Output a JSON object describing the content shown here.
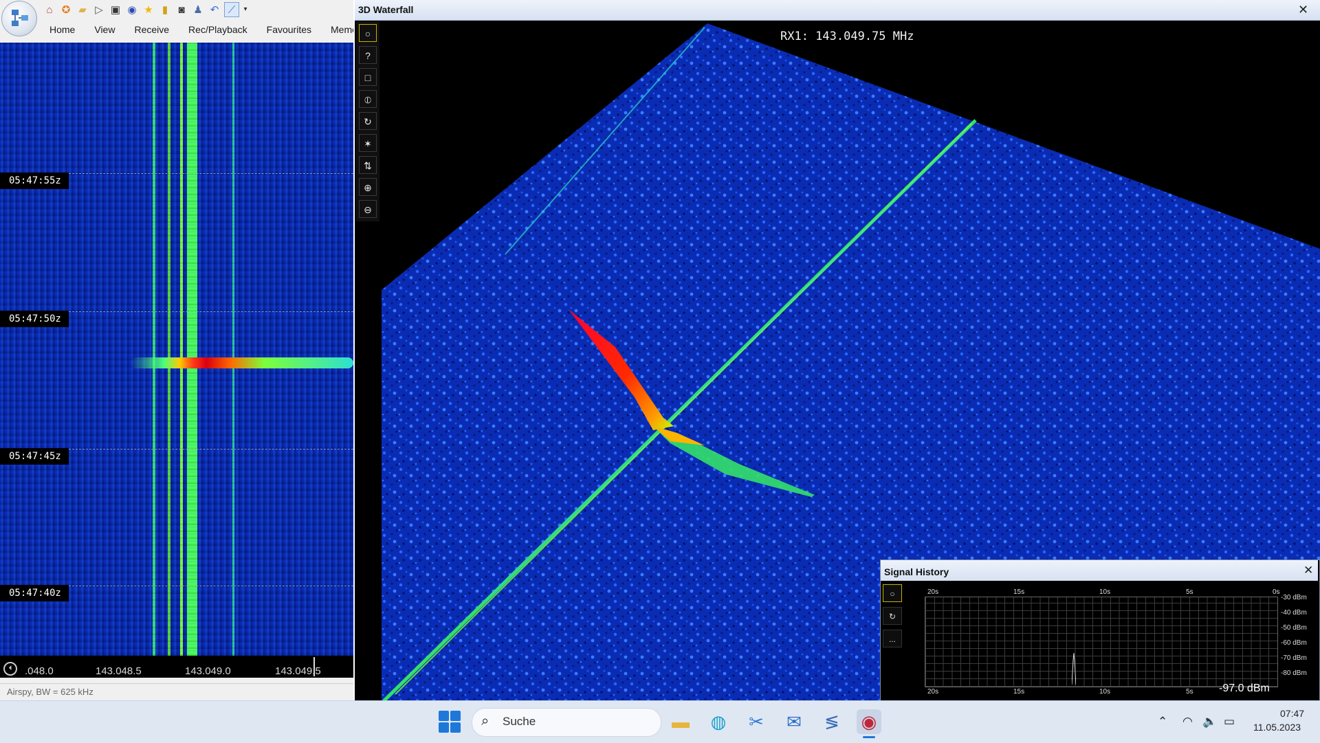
{
  "quick_access": {
    "icons": [
      "home-icon",
      "help-ring-icon",
      "folder-icon",
      "play-icon",
      "stop-icon",
      "radio-icon",
      "star-icon",
      "lock-icon",
      "camera-icon",
      "user-icon",
      "undo-icon",
      "spectrum-icon",
      "dropdown-icon"
    ]
  },
  "menu": {
    "tabs": [
      "Home",
      "View",
      "Receive",
      "Rec/Playback",
      "Favourites",
      "Memor"
    ]
  },
  "left_waterfall": {
    "timestamps": [
      "05:47:55z",
      "05:47:50z",
      "05:47:45z",
      "05:47:40z"
    ],
    "freq_ticks": [
      ".048.0",
      "143.048.5",
      "143.049.0",
      "143.049.5"
    ],
    "status": "Airspy, BW = 625 kHz"
  },
  "waterfall_3d": {
    "title": "3D Waterfall",
    "close": "✕",
    "rx_label": "RX1: 143.049.75 MHz",
    "tools": [
      "○",
      "?",
      "□",
      "⦶",
      "↻",
      "✶",
      "⇅",
      "⊕",
      "⊖"
    ]
  },
  "signal_history": {
    "title": "Signal History",
    "close": "✕",
    "tools": [
      "○",
      "↻",
      "..."
    ],
    "x_ticks": [
      "20s",
      "15s",
      "10s",
      "5s",
      "0s"
    ],
    "y_ticks": [
      "-30 dBm",
      "-40 dBm",
      "-50 dBm",
      "-60 dBm",
      "-70 dBm",
      "-80 dBm"
    ],
    "readout": "-97.0 dBm"
  },
  "taskbar": {
    "search_placeholder": "Suche",
    "time": "07:47",
    "date": "11.05.2023"
  },
  "colors": {
    "waterfall_blue": "#0b26a8",
    "signal_green": "#4cff5a",
    "signal_red": "#e0001a",
    "accent": "#1e78d8"
  }
}
